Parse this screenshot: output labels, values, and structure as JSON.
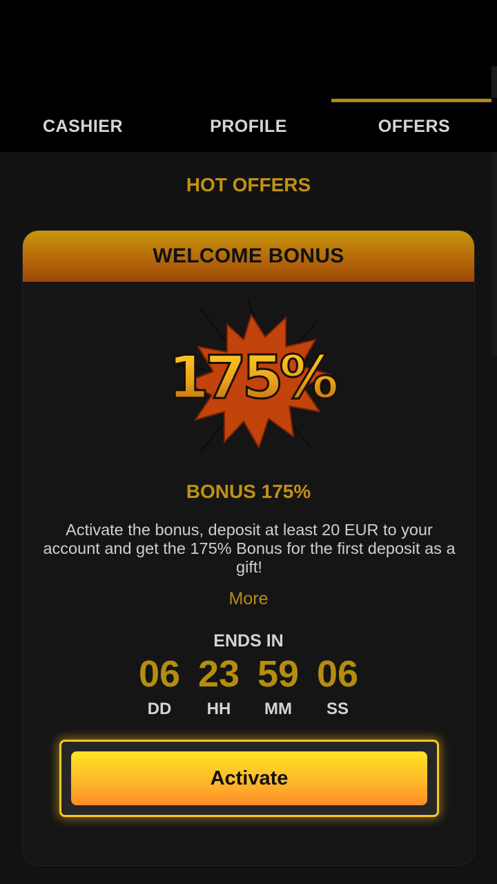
{
  "tabs": [
    {
      "label": "CASHIER",
      "active": false
    },
    {
      "label": "PROFILE",
      "active": false
    },
    {
      "label": "OFFERS",
      "active": true
    }
  ],
  "section_title": "HOT OFFERS",
  "offer": {
    "header": "WELCOME BONUS",
    "badge_text": "175%",
    "title": "BONUS 175%",
    "description": "Activate the bonus, deposit at least 20 EUR to your account and get the 175% Bonus for the first deposit as a gift!",
    "more_label": "More",
    "ends_label": "ENDS IN",
    "timer": [
      {
        "value": "06",
        "label": "DD"
      },
      {
        "value": "23",
        "label": "HH"
      },
      {
        "value": "59",
        "label": "MM"
      },
      {
        "value": "06",
        "label": "SS"
      }
    ],
    "activate_label": "Activate"
  },
  "colors": {
    "accent_gold": "#c09212",
    "button_yellow": "#ffe324",
    "button_orange": "#ff8c2a",
    "header_orange": "#b3650a"
  },
  "icons": {
    "badge": "comic-burst-icon"
  }
}
